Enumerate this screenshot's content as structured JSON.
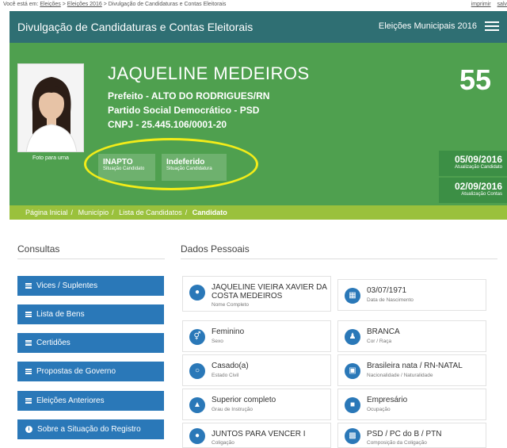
{
  "topstrip": {
    "prefix": "Você está em:",
    "crumbs": [
      "Eleições",
      "Eleições 2016",
      "Divulgação de Candidaturas e Contas Eleitorais"
    ],
    "actions": [
      "imprimir",
      "salv"
    ]
  },
  "navbar": {
    "title": "Divulgação de Candidaturas e Contas Eleitorais",
    "right_label": "Eleições Municipais 2016"
  },
  "candidate": {
    "name": "JAQUELINE MEDEIROS",
    "office": "Prefeito - ALTO DO RODRIGUES/RN",
    "party": "Partido Social Democrático - PSD",
    "cnpj": "CNPJ - 25.445.106/0001-20",
    "number": "55",
    "photo_caption": "Foto para urna"
  },
  "status": [
    {
      "value": "INAPTO",
      "label": "Situação Candidato"
    },
    {
      "value": "Indeferido",
      "label": "Situação Candidatura"
    }
  ],
  "dates": [
    {
      "value": "05/09/2016",
      "label": "Atualização Candidato"
    },
    {
      "value": "02/09/2016",
      "label": "Atualização Contas"
    }
  ],
  "breadcrumb": [
    "Página Inicial",
    "Município",
    "Lista de Candidatos",
    "Candidato"
  ],
  "consultas": {
    "title": "Consultas",
    "buttons": [
      "Vices / Suplentes",
      "Lista de Bens",
      "Certidões",
      "Propostas de Governo",
      "Eleições Anteriores",
      "Sobre a Situação do Registro"
    ]
  },
  "dados": {
    "title": "Dados Pessoais",
    "cards": [
      {
        "value": "JAQUELINE VIEIRA XAVIER DA COSTA MEDEIROS",
        "label": "Nome Completo",
        "icon": "user-icon"
      },
      {
        "value": "03/07/1971",
        "label": "Data de Nascimento",
        "icon": "calendar-icon"
      },
      {
        "value": "Feminino",
        "label": "Sexo",
        "icon": "gender-icon"
      },
      {
        "value": "BRANCA",
        "label": "Cor / Raça",
        "icon": "person-icon"
      },
      {
        "value": "Casado(a)",
        "label": "Estado Civil",
        "icon": "ring-icon"
      },
      {
        "value": "Brasileira nata / RN-NATAL",
        "label": "Nacionalidade / Naturalidade",
        "icon": "map-icon"
      },
      {
        "value": "Superior completo",
        "label": "Grau de Instrução",
        "icon": "graduation-cap-icon"
      },
      {
        "value": "Empresário",
        "label": "Ocupação",
        "icon": "briefcase-icon"
      },
      {
        "value": "JUNTOS PARA VENCER I",
        "label": "Coligação",
        "icon": "group-icon"
      },
      {
        "value": "PSD / PC do B / PTN",
        "label": "Composição da Coligação",
        "icon": "folder-icon"
      }
    ]
  },
  "colors": {
    "navbar": "#2f6f73",
    "hero": "#4fa04f",
    "breadcrumb": "#9ac13c",
    "button": "#2a78b8",
    "highlight_ellipse": "#f2ec19"
  }
}
